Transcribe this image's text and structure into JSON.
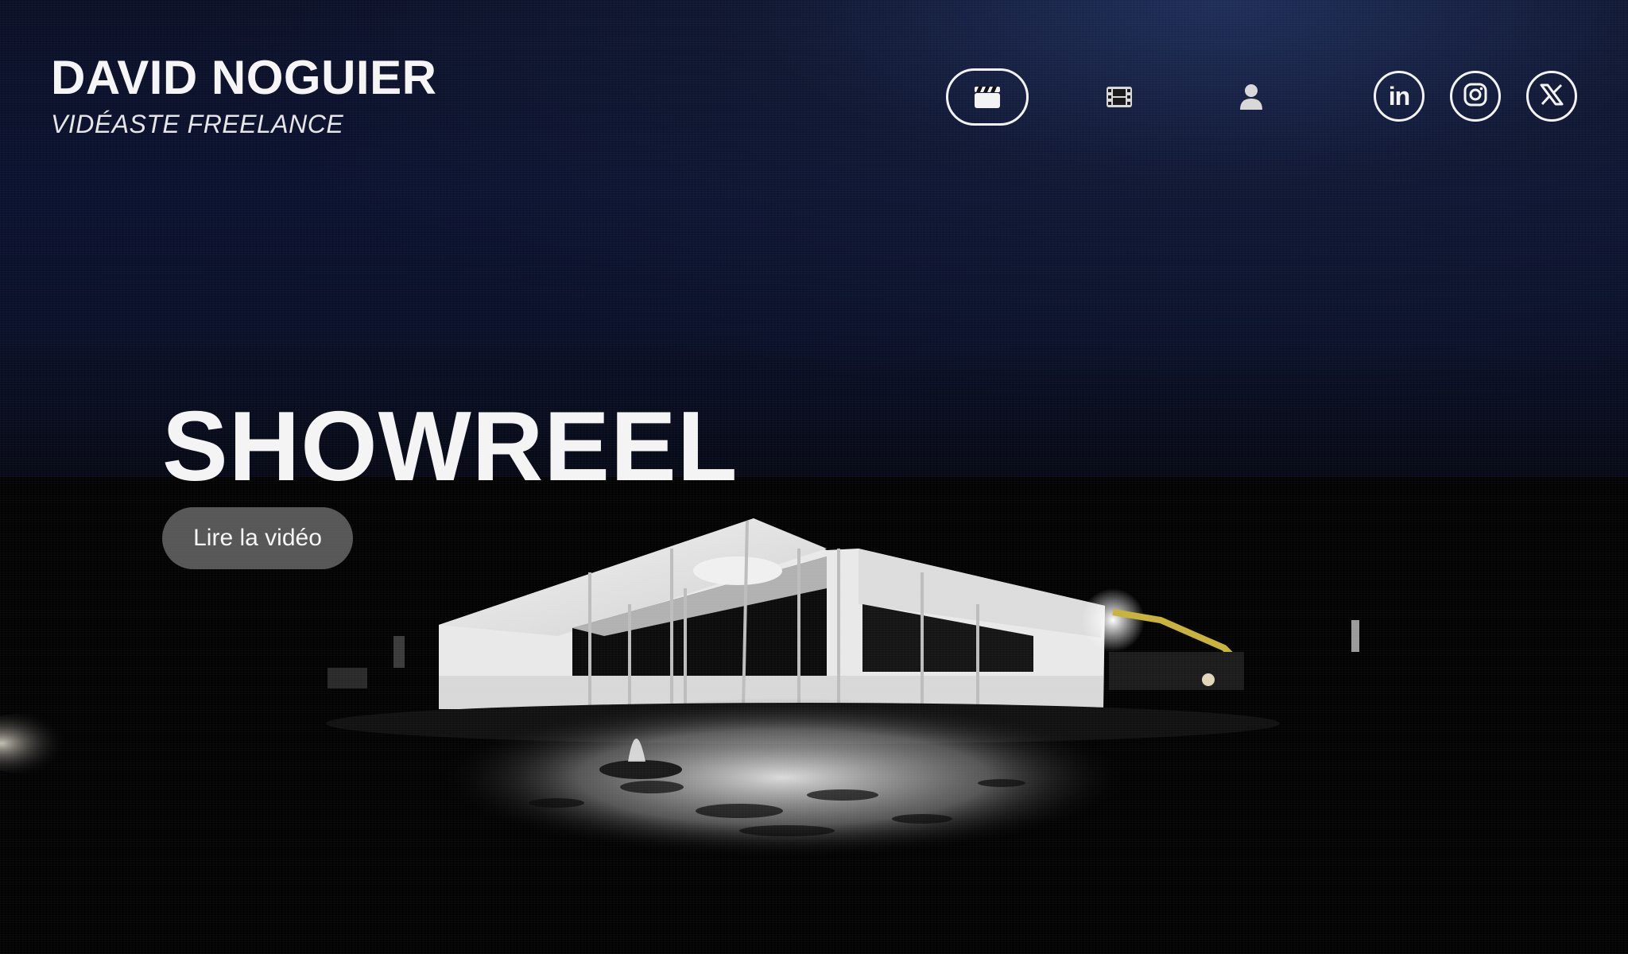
{
  "brand": {
    "name": "DAVID NOGUIER",
    "tagline": "VIDÉASTE FREELANCE"
  },
  "nav": {
    "items": [
      {
        "icon": "clapperboard-icon",
        "active": true
      },
      {
        "icon": "film-strip-icon",
        "active": false
      },
      {
        "icon": "user-icon",
        "active": false
      }
    ]
  },
  "social": {
    "items": [
      {
        "icon": "linkedin-icon",
        "glyph": "in"
      },
      {
        "icon": "instagram-icon",
        "glyph": ""
      },
      {
        "icon": "x-icon",
        "glyph": "𝕏"
      }
    ]
  },
  "hero": {
    "title": "SHOWREEL",
    "play_label": "Lire la vidéo"
  },
  "colors": {
    "text": "#f4f4f4",
    "button_bg": "#787878",
    "sky_top": "#0b1230",
    "ground": "#030304"
  }
}
